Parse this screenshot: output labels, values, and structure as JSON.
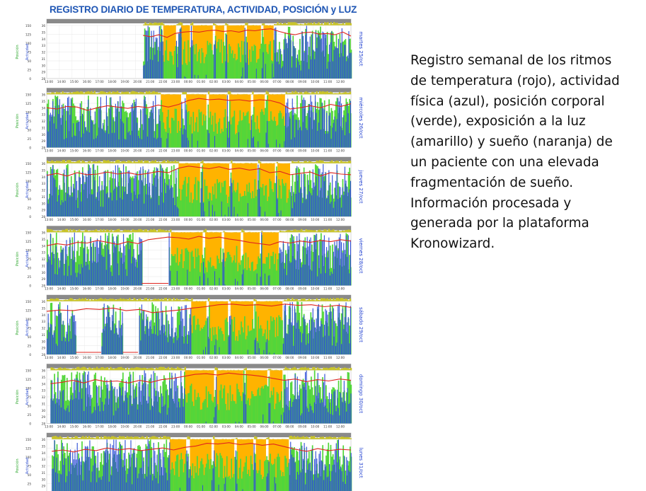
{
  "title": "REGISTRO DIARIO DE TEMPERATURA, ACTIVIDAD, POSICIÓN y LUZ",
  "caption_lines": [
    "Registro semanal de los ritmos",
    "de temperatura (rojo), actividad",
    "física (azul), posición corporal",
    "(verde), exposición a la luz",
    "(amarillo) y sueño (naranja) de",
    "un paciente con una elevada",
    "fragmentación de sueño.",
    "Información procesada y",
    "generada por la plataforma",
    "Kronowizard."
  ],
  "colors": {
    "temperature": "#e0251f",
    "activity": "#2f4fd6",
    "position": "#52d63a",
    "light": "#c9c42a",
    "sleep": "#ffb300",
    "header_band": "#8a8a8a",
    "title": "#1f56b4"
  },
  "chart_data": [
    {
      "type": "area",
      "day_label": "martes 25/oct",
      "y_left_label": "Posición",
      "y_mid_label": "Actividad",
      "y_ticks_position": [
        "150",
        "125",
        "100",
        "75",
        "50",
        "25",
        "0"
      ],
      "y_ticks_temp": [
        "36",
        "35",
        "34",
        "33",
        "32",
        "31",
        "30",
        "29",
        "28"
      ],
      "x_ticks": [
        "13:00",
        "14:00",
        "15:00",
        "16:00",
        "17:00",
        "18:00",
        "19:00",
        "20:00",
        "21:00",
        "22:00",
        "23:00",
        "00:00",
        "01:00",
        "02:00",
        "03:00",
        "04:00",
        "05:00",
        "06:00",
        "07:00",
        "08:00",
        "09:00",
        "10:00",
        "11:00",
        "12:00"
      ],
      "data_start_hour": 7.6,
      "sleep_periods": [
        [
          9.2,
          10.2
        ],
        [
          10.6,
          11.3
        ],
        [
          11.5,
          13.1
        ],
        [
          13.3,
          14.0
        ],
        [
          14.2,
          15.6
        ],
        [
          15.8,
          16.9
        ],
        [
          17.1,
          17.9
        ]
      ],
      "temperature": [
        34.5,
        34.3,
        34.6,
        34.2,
        34.8,
        35.0,
        35.1,
        35.0,
        35.2,
        35.3,
        35.1,
        35.2,
        35.0,
        35.3,
        35.2,
        35.4,
        35.5,
        35.1,
        34.8,
        34.6,
        34.9,
        35.0,
        34.7,
        34.8,
        34.6,
        35.0,
        34.4
      ]
    },
    {
      "type": "area",
      "day_label": "miércoles 26/oct",
      "y_left_label": "Posición",
      "y_mid_label": "Actividad",
      "y_ticks_position": [
        "150",
        "125",
        "100",
        "75",
        "50",
        "25",
        "0"
      ],
      "y_ticks_temp": [
        "36",
        "35",
        "34",
        "33",
        "32",
        "31",
        "30",
        "29",
        "28"
      ],
      "x_ticks": [
        "13:00",
        "14:00",
        "15:00",
        "16:00",
        "17:00",
        "18:00",
        "19:00",
        "20:00",
        "21:00",
        "22:00",
        "23:00",
        "00:00",
        "01:00",
        "02:00",
        "03:00",
        "04:00",
        "05:00",
        "06:00",
        "07:00",
        "08:00",
        "09:00",
        "10:00",
        "11:00",
        "12:00"
      ],
      "data_start_hour": 0,
      "sleep_periods": [
        [
          9.0,
          10.6
        ],
        [
          11.0,
          12.6
        ],
        [
          12.8,
          14.2
        ],
        [
          14.4,
          16.1
        ],
        [
          16.3,
          17.2
        ],
        [
          17.4,
          18.8
        ]
      ],
      "temperature": [
        34.0,
        33.8,
        34.2,
        34.1,
        33.6,
        34.0,
        34.3,
        34.1,
        33.9,
        34.2,
        34.0,
        34.4,
        34.1,
        34.5,
        35.1,
        35.4,
        35.2,
        35.3,
        35.1,
        35.2,
        35.0,
        35.2,
        35.1,
        34.7,
        33.8,
        34.0,
        34.3,
        34.0,
        34.5,
        34.2,
        34.6
      ]
    },
    {
      "type": "area",
      "day_label": "jueves 27/oct",
      "y_left_label": "Posición",
      "y_mid_label": "Actividad",
      "y_ticks_position": [
        "150",
        "125",
        "100",
        "75",
        "50",
        "25",
        "0"
      ],
      "y_ticks_temp": [
        "36",
        "35",
        "34",
        "33",
        "32",
        "31",
        "30",
        "29",
        "28"
      ],
      "x_ticks": [
        "13:00",
        "14:00",
        "15:00",
        "16:00",
        "17:00",
        "18:00",
        "19:00",
        "20:00",
        "21:00",
        "22:00",
        "23:00",
        "00:00",
        "01:00",
        "02:00",
        "03:00",
        "04:00",
        "05:00",
        "06:00",
        "07:00",
        "08:00",
        "09:00",
        "10:00",
        "11:00",
        "12:00"
      ],
      "data_start_hour": 0,
      "sleep_periods": [
        [
          10.4,
          12.1
        ],
        [
          12.3,
          14.4
        ],
        [
          14.6,
          16.6
        ],
        [
          16.8,
          18.0
        ],
        [
          18.2,
          19.2
        ]
      ],
      "temperature": [
        34.2,
        34.5,
        34.1,
        34.6,
        34.3,
        34.4,
        34.7,
        34.4,
        34.6,
        34.3,
        34.5,
        34.8,
        34.6,
        35.3,
        35.6,
        35.4,
        35.2,
        35.5,
        35.1,
        35.3,
        35.0,
        35.2,
        34.6,
        34.8,
        34.3,
        34.5,
        34.7,
        34.1,
        34.6,
        34.4,
        34.3
      ]
    },
    {
      "type": "area",
      "day_label": "viernes 28/oct",
      "y_left_label": "Posición",
      "y_mid_label": "Actividad",
      "y_ticks_position": [
        "150",
        "125",
        "100",
        "75",
        "50",
        "25",
        "0"
      ],
      "y_ticks_temp": [
        "36",
        "35",
        "34",
        "33",
        "32",
        "31",
        "30",
        "29",
        "28"
      ],
      "x_ticks": [
        "13:00",
        "14:00",
        "15:00",
        "16:00",
        "17:00",
        "18:00",
        "19:00",
        "20:00",
        "21:00",
        "22:00",
        "23:00",
        "00:00",
        "01:00",
        "02:00",
        "03:00",
        "04:00",
        "05:00",
        "06:00",
        "07:00",
        "08:00",
        "09:00",
        "10:00",
        "11:00",
        "12:00"
      ],
      "data_start_hour": 0,
      "gap_hours": [
        [
          7.5,
          9.6
        ]
      ],
      "sleep_periods": [
        [
          9.8,
          12.3
        ],
        [
          12.5,
          13.8
        ],
        [
          14.0,
          15.3
        ],
        [
          15.5,
          16.8
        ],
        [
          17.0,
          18.3
        ]
      ],
      "temperature": [
        34.0,
        34.3,
        34.1,
        34.5,
        34.4,
        34.8,
        34.5,
        34.2,
        34.6,
        34.3,
        34.9,
        35.1,
        35.3,
        35.2,
        35.0,
        35.4,
        35.1,
        35.3,
        35.0,
        34.8,
        34.5,
        34.3,
        34.1,
        34.6,
        34.4,
        34.7,
        34.5,
        34.8,
        34.6,
        34.9,
        34.7
      ]
    },
    {
      "type": "area",
      "day_label": "sábado 29/oct",
      "y_left_label": "Posición",
      "y_mid_label": "Actividad",
      "y_ticks_position": [
        "150",
        "125",
        "100",
        "75",
        "50",
        "25",
        "0"
      ],
      "y_ticks_temp": [
        "36",
        "35",
        "34",
        "33",
        "32",
        "31",
        "30",
        "29",
        "28"
      ],
      "x_ticks": [
        "13:00",
        "14:00",
        "15:00",
        "16:00",
        "17:00",
        "18:00",
        "19:00",
        "20:00",
        "21:00",
        "22:00",
        "23:00",
        "00:00",
        "01:00",
        "02:00",
        "03:00",
        "04:00",
        "05:00",
        "06:00",
        "07:00",
        "08:00",
        "09:00",
        "10:00",
        "11:00",
        "12:00"
      ],
      "data_start_hour": 0,
      "gap_hours": [
        [
          2.3,
          4.3
        ],
        [
          6.0,
          7.2
        ]
      ],
      "sleep_periods": [
        [
          11.4,
          12.6
        ],
        [
          12.8,
          14.3
        ],
        [
          14.5,
          16.3
        ],
        [
          16.5,
          18.6
        ]
      ],
      "temperature": [
        34.5,
        34.7,
        34.6,
        34.9,
        34.8,
        35.0,
        34.6,
        34.8,
        34.3,
        34.5,
        34.7,
        35.0,
        35.2,
        35.5,
        35.6,
        35.4,
        35.5,
        35.3,
        35.6,
        35.4,
        35.5,
        35.2,
        35.4,
        35.1
      ]
    },
    {
      "type": "area",
      "day_label": "domingo 30/oct",
      "y_left_label": "Posición",
      "y_mid_label": "Actividad",
      "y_ticks_position": [
        "150",
        "125",
        "100",
        "75",
        "50",
        "25",
        "0"
      ],
      "y_ticks_temp": [
        "36",
        "35",
        "34",
        "33",
        "32",
        "31",
        "30",
        "29",
        "28"
      ],
      "x_ticks": [
        "13:00",
        "14:00",
        "15:00",
        "16:00",
        "17:00",
        "18:00",
        "19:00",
        "20:00",
        "21:00",
        "22:00",
        "23:00",
        "00:00",
        "01:00",
        "02:00",
        "03:00",
        "04:00",
        "05:00",
        "06:00",
        "07:00",
        "08:00",
        "09:00",
        "10:00",
        "11:00",
        "12:00"
      ],
      "data_start_hour": 0.3,
      "sleep_periods": [
        [
          10.9,
          13.2
        ],
        [
          13.4,
          15.5
        ],
        [
          15.7,
          17.4
        ],
        [
          17.6,
          18.6
        ]
      ],
      "temperature": [
        34.0,
        34.2,
        34.5,
        34.1,
        34.6,
        34.3,
        34.4,
        34.1,
        34.5,
        34.2,
        34.6,
        34.8,
        35.1,
        35.4,
        35.5,
        35.3,
        35.6,
        35.4,
        35.3,
        35.1,
        34.8,
        34.5,
        34.7,
        34.3,
        34.6,
        34.4,
        34.7,
        34.5
      ]
    },
    {
      "type": "area",
      "day_label": "lunes 31/oct",
      "y_left_label": "Posición",
      "y_mid_label": "Actividad",
      "y_ticks_position": [
        "150",
        "125",
        "100",
        "75",
        "50",
        "25",
        "0"
      ],
      "y_ticks_temp": [
        "36",
        "35",
        "34",
        "33",
        "32",
        "31",
        "30",
        "29",
        "28"
      ],
      "x_ticks": [
        "13:00",
        "14:00",
        "15:00",
        "16:00",
        "17:00",
        "18:00",
        "19:00",
        "20:00",
        "21:00",
        "22:00",
        "23:00",
        "00:00",
        "01:00",
        "02:00",
        "03:00",
        "04:00",
        "05:00",
        "06:00",
        "07:00",
        "08:00",
        "09:00",
        "10:00",
        "11:00",
        "12:00"
      ],
      "data_start_hour": 0.4,
      "sleep_periods": [
        [
          9.7,
          11.0
        ],
        [
          11.3,
          13.0
        ],
        [
          13.2,
          14.8
        ],
        [
          15.0,
          16.3
        ],
        [
          16.5,
          17.3
        ],
        [
          17.5,
          19.1
        ]
      ],
      "temperature": [
        34.2,
        34.4,
        34.1,
        34.5,
        34.3,
        34.7,
        34.4,
        34.6,
        34.3,
        34.5,
        34.7,
        34.4,
        34.8,
        35.0,
        35.4,
        35.3,
        35.5,
        35.2,
        35.4,
        35.1,
        35.3,
        34.9,
        34.5,
        34.2,
        34.6,
        34.3,
        34.5,
        34.4
      ]
    }
  ]
}
